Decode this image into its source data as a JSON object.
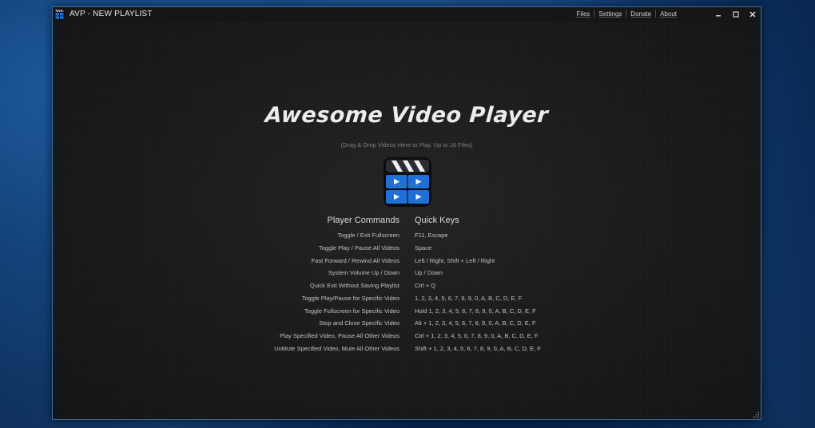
{
  "window": {
    "title": "AVP - NEW PLAYLIST",
    "accent_border": "#3a6fa8",
    "background": "#17181a"
  },
  "menu": {
    "files": "Files",
    "settings": "Settings",
    "donate": "Donate",
    "about": "About"
  },
  "window_controls": {
    "minimize": "▬",
    "maximize": "▢",
    "close": "✕"
  },
  "main": {
    "title": "Awesome Video Player",
    "subtitle": "(Drag & Drop Videos Here to Play. Up to 16 Files)",
    "logo_icon": "clapperboard-grid-icon",
    "logo_colors": {
      "top": "#2a2c30",
      "cells": "#1f6fd6",
      "frame": "#0b0c0e"
    }
  },
  "commands": {
    "left_header": "Player Commands",
    "right_header": "Quick Keys",
    "rows": [
      {
        "command": "Toggle / Exit Fullscreen",
        "keys": "F11, Escape"
      },
      {
        "command": "Toggle Play / Pause All Videos",
        "keys": "Space"
      },
      {
        "command": "Fast Forward / Rewind All Videos",
        "keys": "Left / Right, Shift + Left / Right"
      },
      {
        "command": "System Volume Up / Down",
        "keys": "Up / Down"
      },
      {
        "command": "Quick Exit Without Saving Playlist",
        "keys": "Ctrl + Q"
      },
      {
        "command": "Toggle Play/Pause for Specific Video",
        "keys": "1, 2, 3, 4, 5, 6, 7, 8, 9, 0, A, B, C, D, E, F"
      },
      {
        "command": "Toggle Fullscreen for Specific Video",
        "keys": "Hold 1, 2, 3, 4, 5, 6, 7, 8, 9, 0, A, B, C, D, E, F"
      },
      {
        "command": "Stop and Close Specific Video",
        "keys": "Alt + 1, 2, 3, 4, 5, 6, 7, 8, 9, 0, A, B, C, D, E, F"
      },
      {
        "command": "Play Specified Video, Pause All Other Videos",
        "keys": "Ctrl + 1, 2, 3, 4, 5, 6, 7, 8, 9, 0, A, B, C, D, E, F"
      },
      {
        "command": "UnMute Specified Video, Mute All Other Videos",
        "keys": "Shift + 1, 2, 3, 4, 5, 6, 7, 8, 9, 0, A, B, C, D, E, F"
      }
    ]
  }
}
